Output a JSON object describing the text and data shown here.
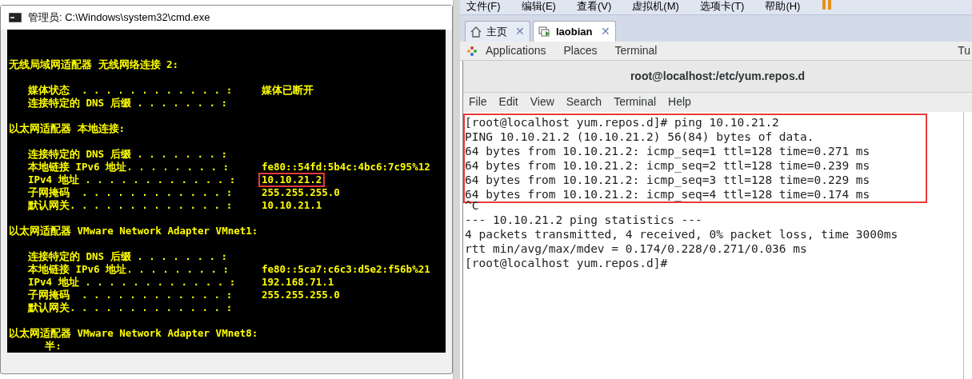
{
  "cmd_window": {
    "title": "管理员: C:\\Windows\\system32\\cmd.exe",
    "lines": [
      {
        "kind": "blank"
      },
      {
        "kind": "heading",
        "text": "无线局域网适配器 无线网络连接 2:"
      },
      {
        "kind": "blank"
      },
      {
        "kind": "field",
        "label": "媒体状态  . . . . . . . . . . . . :",
        "value": "媒体已断开"
      },
      {
        "kind": "field",
        "label": "连接特定的 DNS 后缀 . . . . . . . :"
      },
      {
        "kind": "blank"
      },
      {
        "kind": "heading",
        "text": "以太网适配器 本地连接:"
      },
      {
        "kind": "blank"
      },
      {
        "kind": "field",
        "label": "连接特定的 DNS 后缀 . . . . . . . :"
      },
      {
        "kind": "field",
        "label": "本地链接 IPv6 地址. . . . . . . . :",
        "value": "fe80::54fd:5b4c:4bc6:7c95%12"
      },
      {
        "kind": "field",
        "label": "IPv4 地址 . . . . . . . . . . . . :",
        "value": "10.10.21.2",
        "highlighted": true
      },
      {
        "kind": "field",
        "label": "子网掩码  . . . . . . . . . . . . :",
        "value": "255.255.255.0"
      },
      {
        "kind": "field",
        "label": "默认网关. . . . . . . . . . . . . :",
        "value": "10.10.21.1"
      },
      {
        "kind": "blank"
      },
      {
        "kind": "heading",
        "text": "以太网适配器 VMware Network Adapter VMnet1:"
      },
      {
        "kind": "blank"
      },
      {
        "kind": "field",
        "label": "连接特定的 DNS 后缀 . . . . . . . :"
      },
      {
        "kind": "field",
        "label": "本地链接 IPv6 地址. . . . . . . . :",
        "value": "fe80::5ca7:c6c3:d5e2:f56b%21"
      },
      {
        "kind": "field",
        "label": "IPv4 地址 . . . . . . . . . . . . :",
        "value": "192.168.71.1"
      },
      {
        "kind": "field",
        "label": "子网掩码  . . . . . . . . . . . . :",
        "value": "255.255.255.0"
      },
      {
        "kind": "field",
        "label": "默认网关. . . . . . . . . . . . . :"
      },
      {
        "kind": "blank"
      },
      {
        "kind": "heading",
        "text": "以太网适配器 VMware Network Adapter VMnet8:"
      },
      {
        "kind": "heading",
        "text": "      半:"
      }
    ]
  },
  "vmware": {
    "menu": [
      "文件(F)",
      "编辑(E)",
      "查看(V)",
      "虚拟机(M)",
      "选项卡(T)",
      "帮助(H)"
    ],
    "tabs": [
      {
        "label": "主页",
        "close": "✕",
        "selected": false
      },
      {
        "label": "laobian",
        "close": "✕",
        "selected": true
      }
    ],
    "gnome_bar": [
      "Applications",
      "Places",
      "Terminal"
    ],
    "gnome_bar_right": "Tu",
    "terminal": {
      "title": "root@localhost:/etc/yum.repos.d",
      "menu": [
        "File",
        "Edit",
        "View",
        "Search",
        "Terminal",
        "Help"
      ],
      "lines": [
        {
          "text": "[root@localhost yum.repos.d]# ping 10.10.21.2",
          "boxed": true
        },
        {
          "text": "PING 10.10.21.2 (10.10.21.2) 56(84) bytes of data.",
          "boxed": true
        },
        {
          "text": "64 bytes from 10.10.21.2: icmp_seq=1 ttl=128 time=0.271 ms",
          "boxed": true
        },
        {
          "text": "64 bytes from 10.10.21.2: icmp_seq=2 ttl=128 time=0.239 ms",
          "boxed": true
        },
        {
          "text": "64 bytes from 10.10.21.2: icmp_seq=3 ttl=128 time=0.229 ms",
          "boxed": true
        },
        {
          "text": "64 bytes from 10.10.21.2: icmp_seq=4 ttl=128 time=0.174 ms",
          "boxed": true
        },
        {
          "text": "^C",
          "boxed": false
        },
        {
          "text": "--- 10.10.21.2 ping statistics ---",
          "boxed": false
        },
        {
          "text": "4 packets transmitted, 4 received, 0% packet loss, time 3000ms",
          "boxed": false
        },
        {
          "text": "rtt min/avg/max/mdev = 0.174/0.228/0.271/0.036 ms",
          "boxed": false
        },
        {
          "text": "[root@localhost yum.repos.d]#",
          "boxed": false
        }
      ]
    }
  }
}
